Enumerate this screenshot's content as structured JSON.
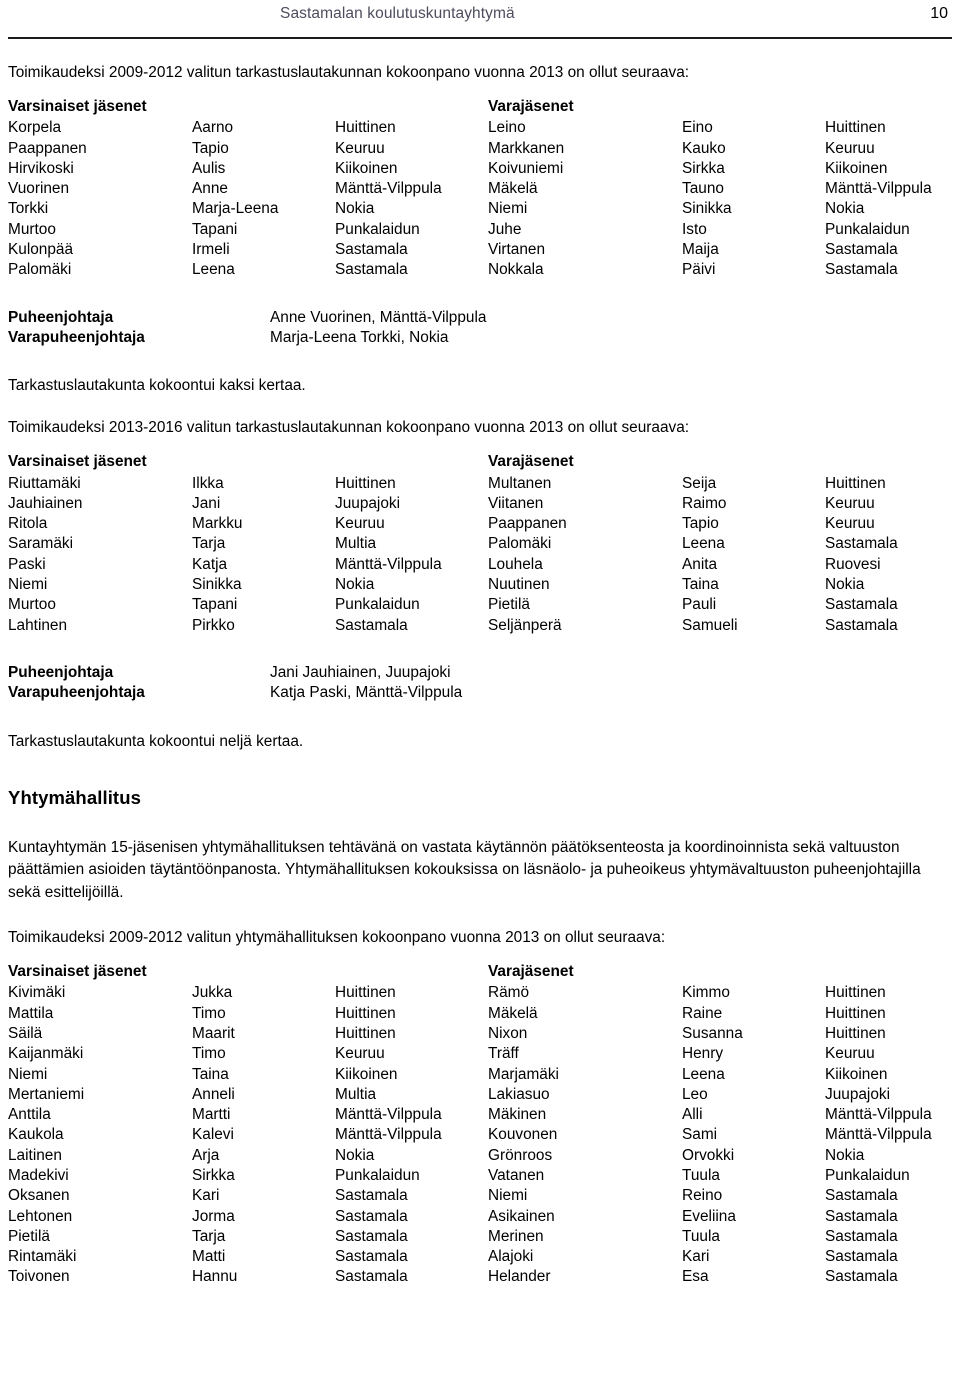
{
  "header": {
    "title": "Sastamalan koulutuskuntayhtymä",
    "page_number": "10"
  },
  "table_headers": {
    "members": "Varsinaiset jäsenet",
    "deputies": "Varajäsenet"
  },
  "chair_labels": {
    "chair": "Puheenjohtaja",
    "vice_chair": "Varapuheenjohtaja"
  },
  "section1": {
    "intro": "Toimikaudeksi 2009-2012 valitun tarkastuslautakunnan kokoonpano vuonna 2013 on ollut seuraava:",
    "rows": [
      {
        "last": "Korpela",
        "first": "Aarno",
        "town": "Huittinen",
        "d_last": "Leino",
        "d_first": "Eino",
        "d_town": "Huittinen"
      },
      {
        "last": "Paappanen",
        "first": "Tapio",
        "town": "Keuruu",
        "d_last": "Markkanen",
        "d_first": "Kauko",
        "d_town": "Keuruu"
      },
      {
        "last": "Hirvikoski",
        "first": "Aulis",
        "town": "Kiikoinen",
        "d_last": "Koivuniemi",
        "d_first": "Sirkka",
        "d_town": "Kiikoinen"
      },
      {
        "last": "Vuorinen",
        "first": "Anne",
        "town": "Mänttä-Vilppula",
        "d_last": "Mäkelä",
        "d_first": "Tauno",
        "d_town": "Mänttä-Vilppula"
      },
      {
        "last": "Torkki",
        "first": "Marja-Leena",
        "town": "Nokia",
        "d_last": "Niemi",
        "d_first": "Sinikka",
        "d_town": "Nokia"
      },
      {
        "last": "Murtoo",
        "first": "Tapani",
        "town": "Punkalaidun",
        "d_last": "Juhe",
        "d_first": "Isto",
        "d_town": "Punkalaidun"
      },
      {
        "last": "Kulonpää",
        "first": "Irmeli",
        "town": "Sastamala",
        "d_last": "Virtanen",
        "d_first": "Maija",
        "d_town": "Sastamala"
      },
      {
        "last": "Palomäki",
        "first": "Leena",
        "town": "Sastamala",
        "d_last": "Nokkala",
        "d_first": "Päivi",
        "d_town": "Sastamala"
      }
    ],
    "chair": "Anne Vuorinen, Mänttä-Vilppula",
    "vice_chair": "Marja-Leena Torkki, Nokia",
    "meeting_note": "Tarkastuslautakunta kokoontui kaksi kertaa."
  },
  "section2": {
    "intro": "Toimikaudeksi 2013-2016 valitun tarkastuslautakunnan kokoonpano vuonna 2013 on ollut seuraava:",
    "rows": [
      {
        "last": "Riuttamäki",
        "first": "Ilkka",
        "town": "Huittinen",
        "d_last": "Multanen",
        "d_first": "Seija",
        "d_town": "Huittinen"
      },
      {
        "last": "Jauhiainen",
        "first": "Jani",
        "town": "Juupajoki",
        "d_last": "Viitanen",
        "d_first": "Raimo",
        "d_town": "Keuruu"
      },
      {
        "last": "Ritola",
        "first": "Markku",
        "town": "Keuruu",
        "d_last": "Paappanen",
        "d_first": "Tapio",
        "d_town": "Keuruu"
      },
      {
        "last": "Saramäki",
        "first": "Tarja",
        "town": "Multia",
        "d_last": "Palomäki",
        "d_first": "Leena",
        "d_town": "Sastamala"
      },
      {
        "last": "Paski",
        "first": "Katja",
        "town": "Mänttä-Vilppula",
        "d_last": "Louhela",
        "d_first": "Anita",
        "d_town": "Ruovesi"
      },
      {
        "last": "Niemi",
        "first": "Sinikka",
        "town": "Nokia",
        "d_last": "Nuutinen",
        "d_first": "Taina",
        "d_town": "Nokia"
      },
      {
        "last": "Murtoo",
        "first": "Tapani",
        "town": "Punkalaidun",
        "d_last": "Pietilä",
        "d_first": "Pauli",
        "d_town": "Sastamala"
      },
      {
        "last": "Lahtinen",
        "first": "Pirkko",
        "town": "Sastamala",
        "d_last": "Seljänperä",
        "d_first": "Samueli",
        "d_town": "Sastamala"
      }
    ],
    "chair": "Jani Jauhiainen, Juupajoki",
    "vice_chair": "Katja Paski, Mänttä-Vilppula",
    "meeting_note": "Tarkastuslautakunta kokoontui neljä kertaa."
  },
  "section3": {
    "heading": "Yhtymähallitus",
    "paragraph": "Kuntayhtymän 15-jäsenisen yhtymähallituksen tehtävänä on vastata käytännön päätöksenteosta ja koordinoinnista sekä valtuuston päättämien asioiden täytäntöönpanosta. Yhtymähallituksen kokouksissa on läsnäolo- ja puheoikeus yhtymävaltuuston puheenjohtajilla sekä esittelijöillä.",
    "intro": "Toimikaudeksi 2009-2012 valitun yhtymähallituksen kokoonpano vuonna 2013 on ollut seuraava:",
    "rows": [
      {
        "last": "Kivimäki",
        "first": "Jukka",
        "town": "Huittinen",
        "d_last": "Rämö",
        "d_first": "Kimmo",
        "d_town": "Huittinen"
      },
      {
        "last": "Mattila",
        "first": "Timo",
        "town": "Huittinen",
        "d_last": "Mäkelä",
        "d_first": "Raine",
        "d_town": "Huittinen"
      },
      {
        "last": "Säilä",
        "first": "Maarit",
        "town": "Huittinen",
        "d_last": "Nixon",
        "d_first": "Susanna",
        "d_town": "Huittinen"
      },
      {
        "last": "Kaijanmäki",
        "first": "Timo",
        "town": "Keuruu",
        "d_last": "Träff",
        "d_first": "Henry",
        "d_town": "Keuruu"
      },
      {
        "last": "Niemi",
        "first": "Taina",
        "town": "Kiikoinen",
        "d_last": "Marjamäki",
        "d_first": "Leena",
        "d_town": "Kiikoinen"
      },
      {
        "last": "Mertaniemi",
        "first": "Anneli",
        "town": "Multia",
        "d_last": "Lakiasuo",
        "d_first": "Leo",
        "d_town": "Juupajoki"
      },
      {
        "last": "Anttila",
        "first": "Martti",
        "town": "Mänttä-Vilppula",
        "d_last": "Mäkinen",
        "d_first": "Alli",
        "d_town": "Mänttä-Vilppula"
      },
      {
        "last": "Kaukola",
        "first": "Kalevi",
        "town": "Mänttä-Vilppula",
        "d_last": "Kouvonen",
        "d_first": "Sami",
        "d_town": "Mänttä-Vilppula"
      },
      {
        "last": "Laitinen",
        "first": "Arja",
        "town": "Nokia",
        "d_last": "Grönroos",
        "d_first": "Orvokki",
        "d_town": "Nokia"
      },
      {
        "last": "Madekivi",
        "first": "Sirkka",
        "town": "Punkalaidun",
        "d_last": "Vatanen",
        "d_first": "Tuula",
        "d_town": "Punkalaidun"
      },
      {
        "last": "Oksanen",
        "first": "Kari",
        "town": "Sastamala",
        "d_last": "Niemi",
        "d_first": "Reino",
        "d_town": "Sastamala"
      },
      {
        "last": "Lehtonen",
        "first": "Jorma",
        "town": "Sastamala",
        "d_last": "Asikainen",
        "d_first": "Eveliina",
        "d_town": "Sastamala"
      },
      {
        "last": "Pietilä",
        "first": "Tarja",
        "town": "Sastamala",
        "d_last": "Merinen",
        "d_first": "Tuula",
        "d_town": "Sastamala"
      },
      {
        "last": "Rintamäki",
        "first": "Matti",
        "town": "Sastamala",
        "d_last": "Alajoki",
        "d_first": "Kari",
        "d_town": "Sastamala"
      },
      {
        "last": "Toivonen",
        "first": "Hannu",
        "town": "Sastamala",
        "d_last": "Helander",
        "d_first": "Esa",
        "d_town": "Sastamala"
      }
    ]
  }
}
